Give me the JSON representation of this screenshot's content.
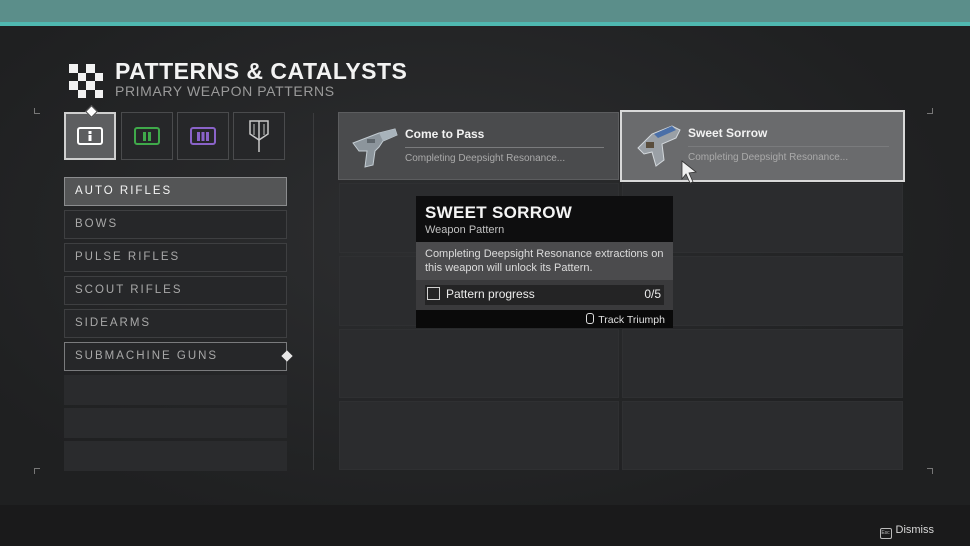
{
  "header": {
    "title": "PATTERNS & CATALYSTS",
    "subtitle": "PRIMARY WEAPON PATTERNS"
  },
  "categories": [
    {
      "icon": "primary-ammo-icon",
      "color": "#ffffff",
      "active": true
    },
    {
      "icon": "special-ammo-icon",
      "color": "#3fa94a",
      "active": false
    },
    {
      "icon": "heavy-ammo-icon",
      "color": "#8a63c9",
      "active": false
    },
    {
      "icon": "catalyst-icon",
      "color": "#c8c8c8",
      "active": false
    }
  ],
  "weapon_types": [
    {
      "label": "AUTO RIFLES",
      "selected": true
    },
    {
      "label": "BOWS",
      "selected": false
    },
    {
      "label": "PULSE RIFLES",
      "selected": false
    },
    {
      "label": "SCOUT RIFLES",
      "selected": false
    },
    {
      "label": "SIDEARMS",
      "selected": false
    },
    {
      "label": "SUBMACHINE GUNS",
      "selected": false
    }
  ],
  "patterns": [
    {
      "name": "Come to Pass",
      "desc": "Completing Deepsight Resonance...",
      "selected": false
    },
    {
      "name": "Sweet Sorrow",
      "desc": "Completing Deepsight Resonance...",
      "selected": true
    }
  ],
  "tooltip": {
    "name": "SWEET SORROW",
    "type": "Weapon Pattern",
    "description": "Completing Deepsight Resonance extractions on this weapon will unlock its Pattern.",
    "objective_label": "Pattern progress",
    "objective_value": "0/5",
    "track_label": "Track Triumph"
  },
  "footer": {
    "dismiss_label": "Dismiss",
    "esc_key": "Esc"
  }
}
